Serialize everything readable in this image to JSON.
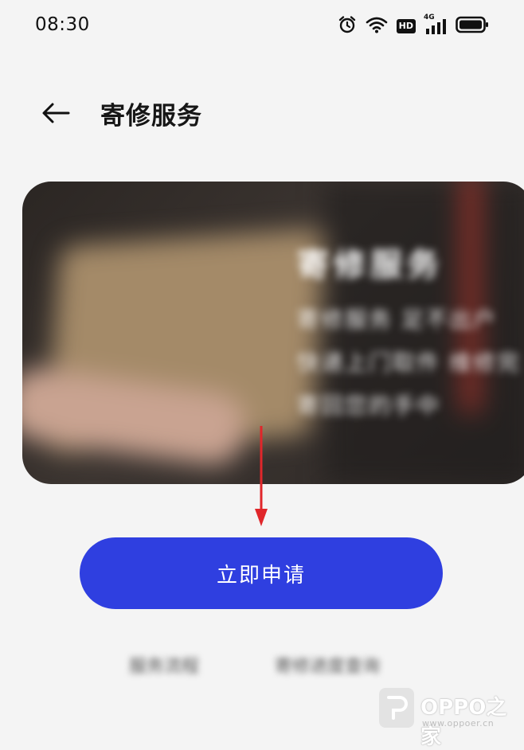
{
  "status_bar": {
    "time": "08:30",
    "hd_label": "HD",
    "network_label": "4G",
    "icons": [
      "alarm-icon",
      "wifi-icon",
      "hd-icon",
      "signal-icon",
      "battery-icon"
    ]
  },
  "header": {
    "back_icon": "arrow-left-icon",
    "title": "寄修服务"
  },
  "banner": {
    "title": "寄修服务",
    "lines": [
      "寄修服务 足不出户",
      "快递上门取件 维修完",
      "寄回您的手中"
    ]
  },
  "actions": {
    "apply_label": "立即申请",
    "link_left": "服务流程",
    "link_right": "寄修进度查询"
  },
  "annotation": {
    "arrow_color": "#e0262a"
  },
  "watermark": {
    "title": "OPPO之家",
    "url": "www.oppoer.cn"
  },
  "colors": {
    "accent": "#2f3fe0",
    "background": "#f4f4f4"
  }
}
